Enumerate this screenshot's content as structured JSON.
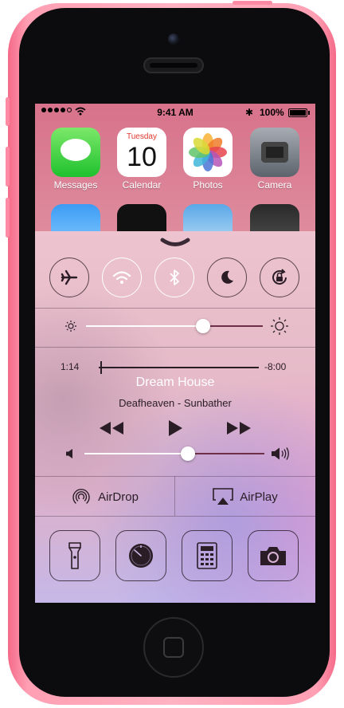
{
  "status_bar": {
    "time": "9:41 AM",
    "battery": "100%"
  },
  "home_apps": [
    {
      "label": "Messages"
    },
    {
      "label": "Calendar",
      "day": "Tuesday",
      "date": "10"
    },
    {
      "label": "Photos"
    },
    {
      "label": "Camera"
    }
  ],
  "control_center": {
    "toggles": [
      {
        "name": "airplane-mode",
        "state": "off"
      },
      {
        "name": "wifi",
        "state": "on"
      },
      {
        "name": "bluetooth",
        "state": "on"
      },
      {
        "name": "do-not-disturb",
        "state": "off"
      },
      {
        "name": "rotation-lock",
        "state": "off"
      }
    ],
    "brightness": {
      "level": 0.66
    },
    "now_playing": {
      "elapsed": "1:14",
      "remaining": "-8:00",
      "progress": 0.13,
      "title": "Dream House",
      "subtitle": "Deafheaven - Sunbather"
    },
    "volume": {
      "level": 0.57
    },
    "airdrop_label": "AirDrop",
    "airplay_label": "AirPlay",
    "shortcuts": [
      {
        "name": "flashlight"
      },
      {
        "name": "timer"
      },
      {
        "name": "calculator"
      },
      {
        "name": "camera"
      }
    ]
  }
}
